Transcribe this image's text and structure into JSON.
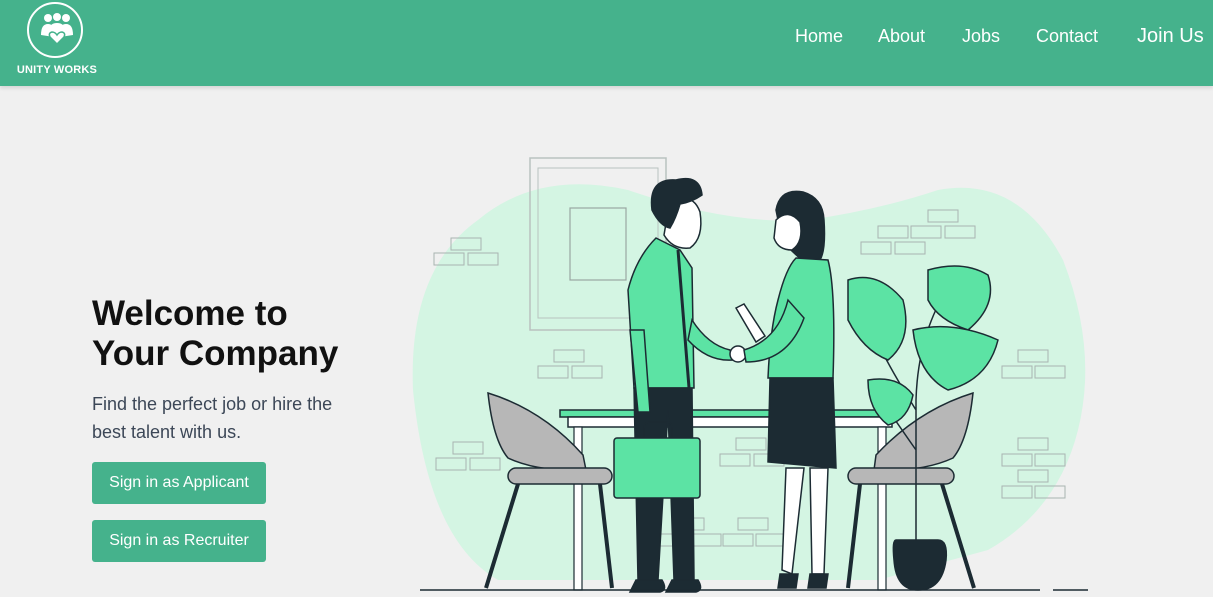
{
  "brand": {
    "name": "UNITY WORKS",
    "logo_icon": "people-heart-icon"
  },
  "nav": {
    "items": [
      {
        "label": "Home"
      },
      {
        "label": "About"
      },
      {
        "label": "Jobs"
      },
      {
        "label": "Contact"
      },
      {
        "label": "Join Us"
      }
    ]
  },
  "hero": {
    "title_line1": "Welcome to",
    "title_line2": "Your Company",
    "subtitle": "Find the perfect job or hire the best talent with us.",
    "applicant_button": "Sign in as Applicant",
    "recruiter_button": "Sign in as Recruiter",
    "illustration_icon": "handshake-illustration"
  },
  "colors": {
    "primary": "#45b28c",
    "background": "#f0f0f0",
    "blob": "#d4f5e3",
    "accent_green": "#5ce3a4",
    "dark": "#1c2b33"
  }
}
